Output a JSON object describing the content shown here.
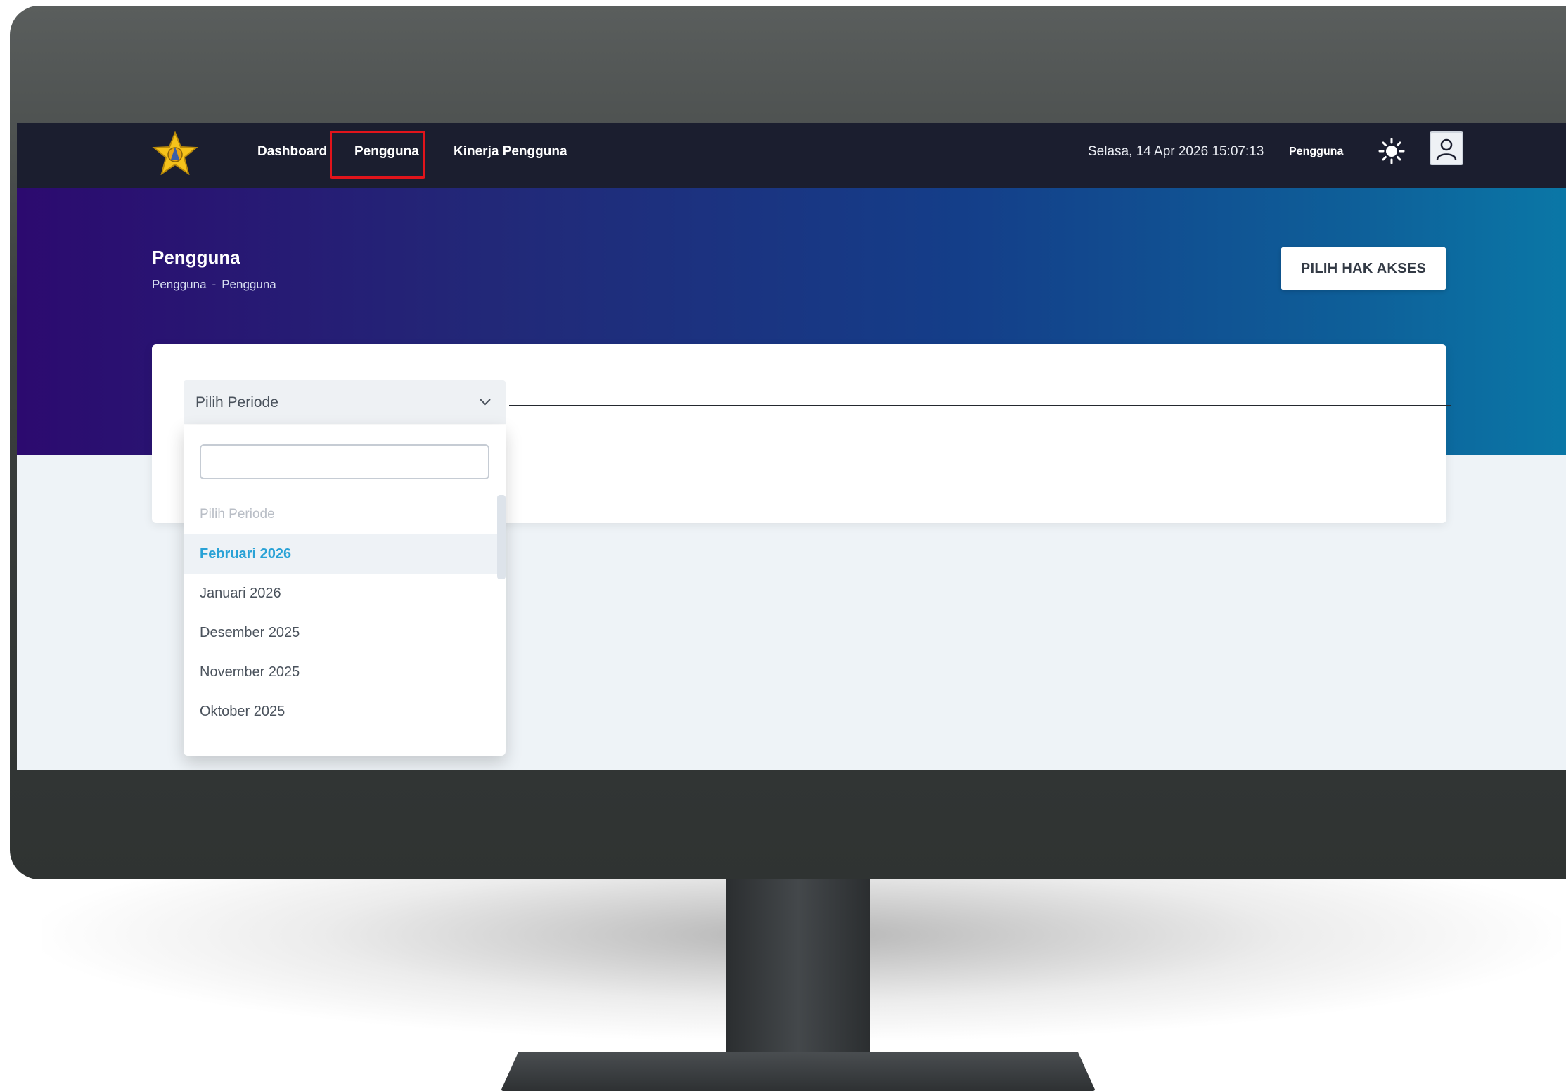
{
  "navbar": {
    "links": [
      "Dashboard",
      "Pengguna",
      "Kinerja Pengguna"
    ],
    "active_link": "Pengguna",
    "datetime": "Selasa, 14 Apr 2026 15:07:13",
    "role": "Pengguna",
    "icons": [
      "logo-emblem",
      "sun-icon",
      "user-avatar-icon"
    ]
  },
  "header": {
    "title": "Pengguna",
    "breadcrumb": [
      "Pengguna",
      "Pengguna"
    ],
    "breadcrumb_separator": "-",
    "access_button": "PILIH HAK AKSES"
  },
  "period_select": {
    "selected_label": "Pilih Periode",
    "search_value": "",
    "options": [
      "Pilih Periode",
      "Februari 2026",
      "Januari 2026",
      "Desember 2025",
      "November 2025",
      "Oktober 2025"
    ],
    "highlighted_option": "Februari 2026"
  },
  "colors": {
    "navbar_bg": "#1b1e2f",
    "hero_start": "#2c0a6f",
    "hero_end": "#0a7aa8",
    "highlight_box": "#e1141b",
    "selected_option_text": "#2aa2d6"
  }
}
